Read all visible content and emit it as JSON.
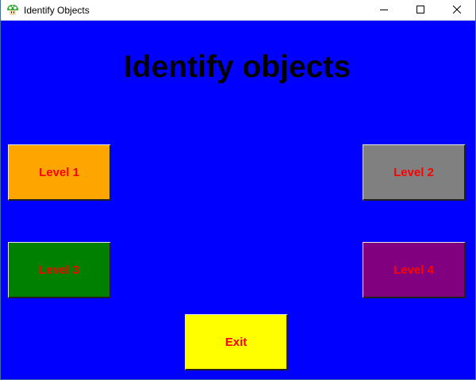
{
  "window": {
    "title": "Identify Objects",
    "app_icon": "mushroom-icon",
    "controls": {
      "minimize_icon": "minimize-icon",
      "maximize_icon": "maximize-icon",
      "close_icon": "close-icon"
    }
  },
  "main": {
    "heading": "Identify objects",
    "background_color": "#0000ff",
    "buttons": {
      "level1": {
        "label": "Level 1",
        "color": "#ffa500"
      },
      "level2": {
        "label": "Level 2",
        "color": "#808080"
      },
      "level3": {
        "label": "Level 3",
        "color": "#008000"
      },
      "level4": {
        "label": "Level 4",
        "color": "#800080"
      },
      "exit": {
        "label": "Exit",
        "color": "#ffff00"
      }
    },
    "button_text_color": "#ff0000"
  }
}
